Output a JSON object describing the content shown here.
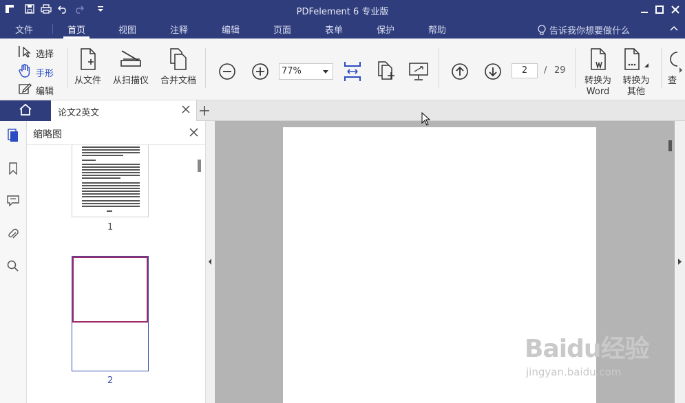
{
  "app": {
    "title": "PDFelement  6 专业版"
  },
  "menu": {
    "items": [
      "文件",
      "首页",
      "视图",
      "注释",
      "编辑",
      "页面",
      "表单",
      "保护",
      "帮助"
    ],
    "active": "首页",
    "tell_me": "告诉我你想要做什么"
  },
  "ribbon": {
    "tools": [
      "选择",
      "手形",
      "编辑"
    ],
    "from_file": "从文件",
    "from_scanner": "从扫描仪",
    "combine": "合并文档",
    "zoom_value": "77%",
    "page_current": "2",
    "page_sep": "/",
    "page_total": "29",
    "to_word_line1": "转换为",
    "to_word_line2": "Word",
    "to_other_line1": "转换为",
    "to_other_line2": "其他",
    "cut_text": "查"
  },
  "tabs": {
    "doc_name": "论文2英文"
  },
  "thumbnails": {
    "title": "缩略图",
    "pages": [
      "1",
      "2"
    ]
  },
  "watermark": {
    "brand": "Baidu经验",
    "url": "jingyan.baidu.com"
  },
  "colors": {
    "brand": "#2f3d7d",
    "accent_blue": "#2b4cc3",
    "selection": "#9e2a6b"
  }
}
